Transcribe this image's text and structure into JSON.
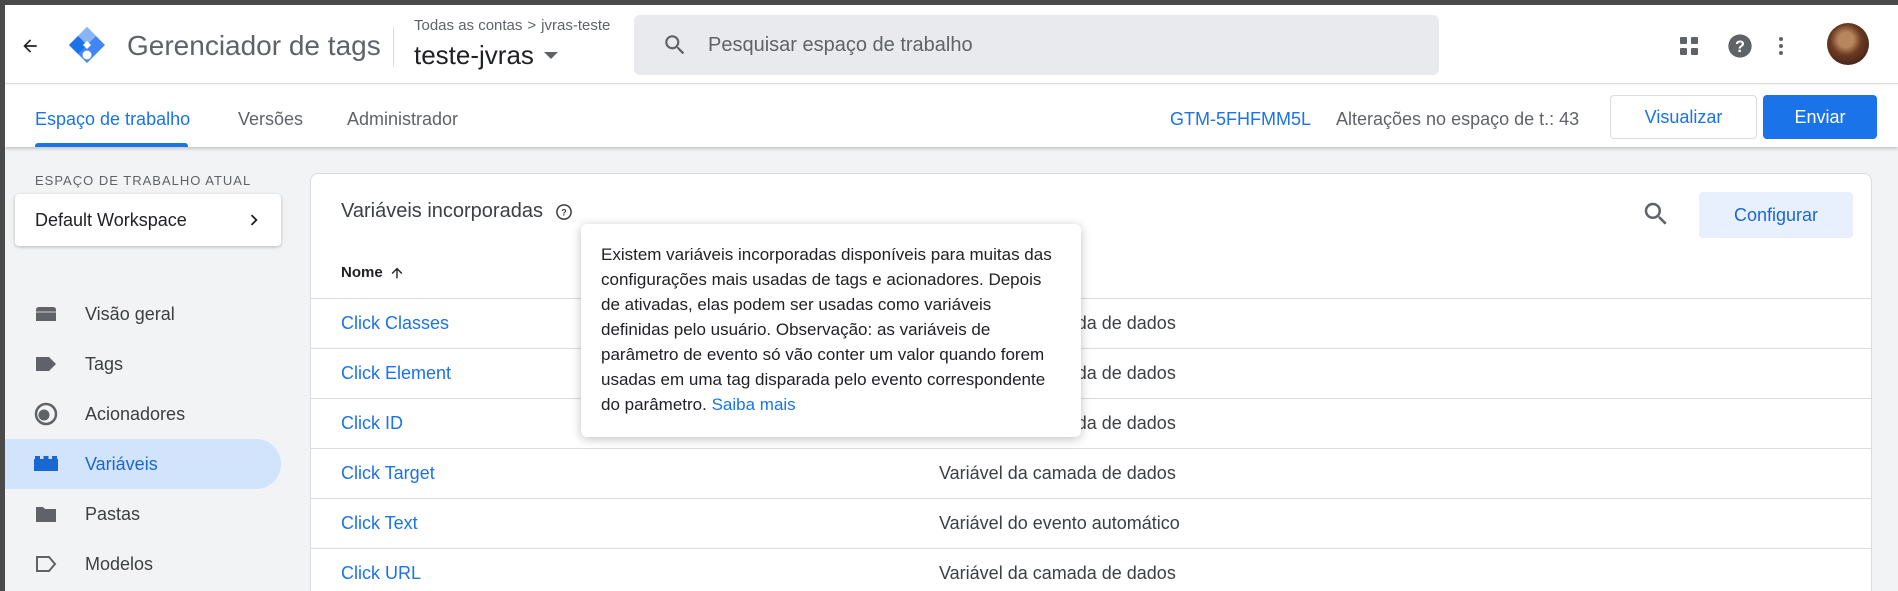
{
  "header": {
    "app_title": "Gerenciador de tags",
    "breadcrumb": {
      "accounts": "Todas as contas",
      "separator": ">",
      "account": "jvras-teste"
    },
    "container_name": "teste-jvras",
    "search_placeholder": "Pesquisar espaço de trabalho",
    "icons": [
      "back-arrow-icon",
      "gtm-logo",
      "search-icon",
      "apps-grid-icon",
      "help-icon",
      "more-vert-icon",
      "avatar"
    ]
  },
  "subnav": {
    "tabs": [
      {
        "label": "Espaço de trabalho",
        "active": true
      },
      {
        "label": "Versões",
        "active": false
      },
      {
        "label": "Administrador",
        "active": false
      }
    ],
    "container_id": "GTM-5FHFMM5L",
    "changes_text": "Alterações no espaço de t.: 43",
    "preview_label": "Visualizar",
    "submit_label": "Enviar"
  },
  "sidebar": {
    "workspace_label": "ESPAÇO DE TRABALHO ATUAL",
    "workspace_name": "Default Workspace",
    "items": [
      {
        "label": "Visão geral",
        "icon": "overview-icon",
        "active": false
      },
      {
        "label": "Tags",
        "icon": "tag-icon",
        "active": false
      },
      {
        "label": "Acionadores",
        "icon": "trigger-icon",
        "active": false
      },
      {
        "label": "Variáveis",
        "icon": "variables-icon",
        "active": true
      },
      {
        "label": "Pastas",
        "icon": "folder-icon",
        "active": false
      },
      {
        "label": "Modelos",
        "icon": "template-icon",
        "active": false
      }
    ]
  },
  "main": {
    "title": "Variáveis incorporadas",
    "configure_label": "Configurar",
    "column_name": "Nome",
    "rows": [
      {
        "name": "Click Classes",
        "type": "Variável da camada de dados"
      },
      {
        "name": "Click Element",
        "type": "Variável da camada de dados"
      },
      {
        "name": "Click ID",
        "type": "Variável da camada de dados"
      },
      {
        "name": "Click Target",
        "type": "Variável da camada de dados"
      },
      {
        "name": "Click Text",
        "type": "Variável do evento automático"
      },
      {
        "name": "Click URL",
        "type": "Variável da camada de dados"
      }
    ]
  },
  "tooltip": {
    "text": "Existem variáveis incorporadas disponíveis para muitas das configurações mais usadas de tags e acionadores. Depois de ativadas, elas podem ser usadas como variáveis definidas pelo usuário. Observação: as variáveis de parâmetro de evento só vão conter um valor quando forem usadas em uma tag disparada pelo evento correspondente do parâmetro.",
    "link": "Saiba mais"
  },
  "colors": {
    "accent": "#1a73e8",
    "active_nav_bg": "#d2e3fc",
    "config_button_bg": "#e8f0fe"
  }
}
